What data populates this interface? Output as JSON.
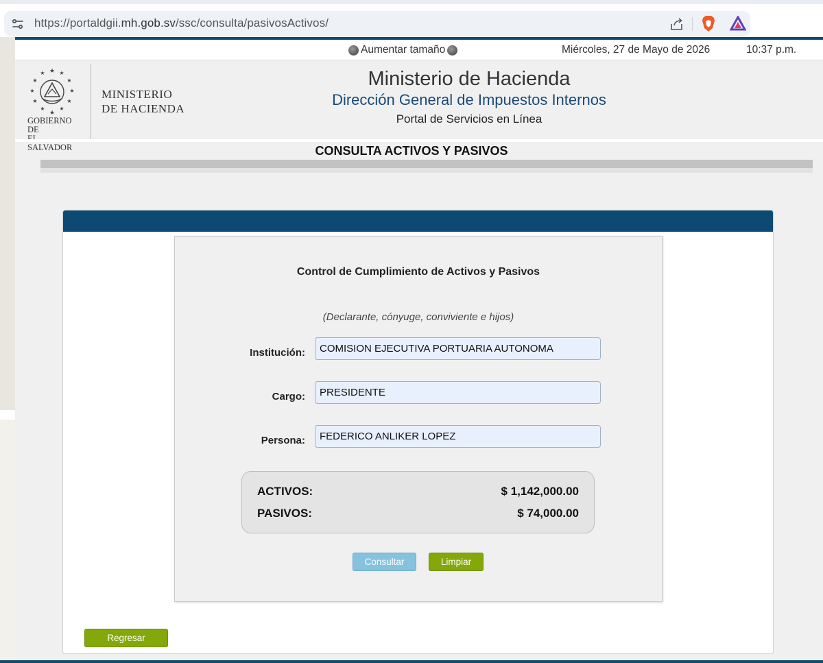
{
  "browser": {
    "url_base": "https://portaldgii.",
    "url_domain": "mh.gob.sv",
    "url_path": "/ssc/consulta/pasivosActivos/"
  },
  "info_bar": {
    "font_size_label": "Aumentar tamaño",
    "date": "Miércoles, 27 de Mayo de 2026",
    "time": "10:37 p.m."
  },
  "logo": {
    "line1": "GOBIERNO DE",
    "line2": "EL SALVADOR",
    "ministry_line1": "MINISTERIO",
    "ministry_line2": "DE HACIENDA"
  },
  "header": {
    "title": "Ministerio de Hacienda",
    "subtitle": "Dirección General de Impuestos Internos",
    "portal": "Portal de Servicios en Línea"
  },
  "page_title": "CONSULTA ACTIVOS Y PASIVOS",
  "form": {
    "title": "Control de Cumplimiento de Activos y Pasivos",
    "subtitle": "(Declarante, cónyuge, conviviente e hijos)",
    "fields": [
      {
        "label": "Institución:",
        "value": "COMISION EJECUTIVA PORTUARIA AUTONOMA"
      },
      {
        "label": "Cargo:",
        "value": "PRESIDENTE"
      },
      {
        "label": "Persona:",
        "value": "FEDERICO ANLIKER LOPEZ"
      }
    ],
    "totals": {
      "activos_label": "ACTIVOS:",
      "activos_value": "$ 1,142,000.00",
      "pasivos_label": "PASIVOS:",
      "pasivos_value": "$ 74,000.00"
    },
    "buttons": {
      "consultar": "Consultar",
      "limpiar": "Limpiar"
    }
  },
  "back_button": "Regresar",
  "colors": {
    "header_blue": "#0c4a73",
    "button_green": "#84a80a",
    "button_blue": "#85c2dd",
    "subtitle_blue": "#1a4a78"
  },
  "icons": [
    "site-settings-icon",
    "share-icon",
    "brave-shield-icon",
    "brave-rewards-icon",
    "globe-icon",
    "coat-of-arms-icon"
  ]
}
